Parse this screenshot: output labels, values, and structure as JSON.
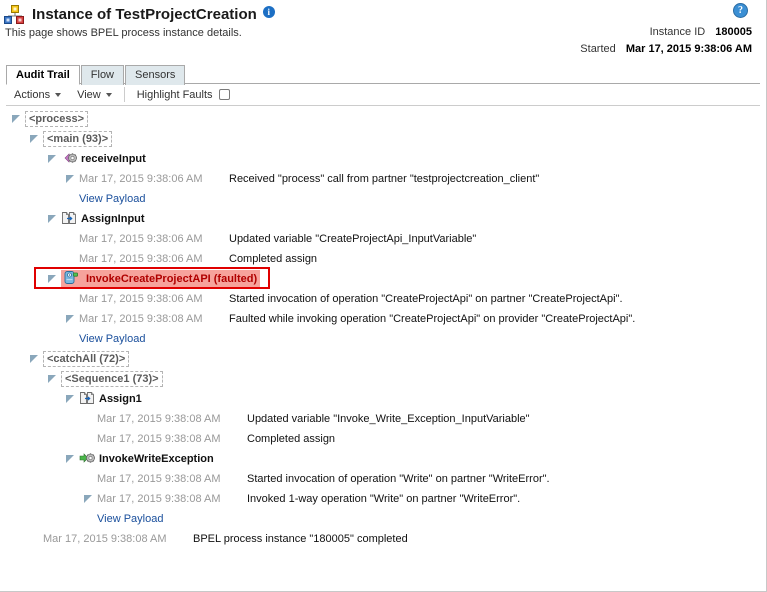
{
  "header": {
    "title": "Instance of TestProjectCreation",
    "subtitle": "This page shows BPEL process instance details.",
    "info_icon": "info-icon",
    "help_icon": "help-icon",
    "hierarchy_icon": "hierarchy-icon",
    "instance_id_label": "Instance ID",
    "instance_id_value": "180005",
    "started_label": "Started",
    "started_value": "Mar 17, 2015 9:38:06 AM"
  },
  "tabs": [
    {
      "label": "Audit Trail",
      "active": true
    },
    {
      "label": "Flow",
      "active": false
    },
    {
      "label": "Sensors",
      "active": false
    }
  ],
  "toolbar": {
    "actions_label": "Actions",
    "view_label": "View",
    "highlight_faults_label": "Highlight Faults",
    "highlight_faults_checked": false
  },
  "colors": {
    "fault_border": "#e00000",
    "fault_bg": "#f6a39c",
    "fault_text": "#b00000",
    "link": "#1a4f9c",
    "timestamp": "#999999",
    "tab_active_bg": "#ffffff",
    "tab_inactive_bg": "#dfe8ec"
  },
  "tree": [
    {
      "kind": "dashed",
      "indent": 0,
      "twisty": "open",
      "label": "<process>"
    },
    {
      "kind": "dashed",
      "indent": 1,
      "twisty": "open",
      "label": "<main (93)>"
    },
    {
      "kind": "activity",
      "indent": 2,
      "twisty": "open",
      "icon": "receive-gear-icon",
      "label": "receiveInput"
    },
    {
      "kind": "event",
      "indent": 3,
      "twisty": "open",
      "timestamp": "Mar 17, 2015 9:38:06 AM",
      "detail": "Received \"process\" call from partner \"testprojectcreation_client\""
    },
    {
      "kind": "link",
      "indent": 3,
      "twisty": "blank",
      "label": "View Payload"
    },
    {
      "kind": "activity",
      "indent": 2,
      "twisty": "open",
      "icon": "assign-icon",
      "label": "AssignInput"
    },
    {
      "kind": "event",
      "indent": 3,
      "twisty": "blank",
      "timestamp": "Mar 17, 2015 9:38:06 AM",
      "detail": "Updated variable \"CreateProjectApi_InputVariable\""
    },
    {
      "kind": "event",
      "indent": 3,
      "twisty": "blank",
      "timestamp": "Mar 17, 2015 9:38:06 AM",
      "detail": "Completed assign"
    },
    {
      "kind": "faulted",
      "indent": 2,
      "twisty": "open",
      "icon": "invoke-icon",
      "label": "InvokeCreateProjectAPI (faulted)"
    },
    {
      "kind": "event",
      "indent": 3,
      "twisty": "blank",
      "timestamp": "Mar 17, 2015 9:38:06 AM",
      "detail": "Started invocation of operation \"CreateProjectApi\" on partner \"CreateProjectApi\"."
    },
    {
      "kind": "event",
      "indent": 3,
      "twisty": "open",
      "timestamp": "Mar 17, 2015 9:38:08 AM",
      "detail": "Faulted while invoking operation \"CreateProjectApi\" on provider \"CreateProjectApi\"."
    },
    {
      "kind": "link",
      "indent": 3,
      "twisty": "blank",
      "label": "View Payload"
    },
    {
      "kind": "dashed",
      "indent": 1,
      "twisty": "open",
      "label": "<catchAll (72)>"
    },
    {
      "kind": "dashed",
      "indent": 2,
      "twisty": "open",
      "label": "<Sequence1 (73)>"
    },
    {
      "kind": "activity",
      "indent": 3,
      "twisty": "open",
      "icon": "assign-icon",
      "label": "Assign1"
    },
    {
      "kind": "event",
      "indent": 4,
      "twisty": "blank",
      "timestamp": "Mar 17, 2015 9:38:08 AM",
      "detail": "Updated variable \"Invoke_Write_Exception_InputVariable\""
    },
    {
      "kind": "event",
      "indent": 4,
      "twisty": "blank",
      "timestamp": "Mar 17, 2015 9:38:08 AM",
      "detail": "Completed assign"
    },
    {
      "kind": "activity",
      "indent": 3,
      "twisty": "open",
      "icon": "invoke-gear-icon",
      "label": "InvokeWriteException"
    },
    {
      "kind": "event",
      "indent": 4,
      "twisty": "blank",
      "timestamp": "Mar 17, 2015 9:38:08 AM",
      "detail": "Started invocation of operation \"Write\" on partner \"WriteError\"."
    },
    {
      "kind": "event",
      "indent": 4,
      "twisty": "open",
      "timestamp": "Mar 17, 2015 9:38:08 AM",
      "detail": "Invoked 1-way operation \"Write\" on partner \"WriteError\"."
    },
    {
      "kind": "link",
      "indent": 4,
      "twisty": "blank",
      "label": "View Payload"
    },
    {
      "kind": "event",
      "indent": 1,
      "twisty": "blank",
      "timestamp": "Mar 17, 2015 9:38:08 AM",
      "detail": "BPEL process instance \"180005\" completed"
    }
  ]
}
